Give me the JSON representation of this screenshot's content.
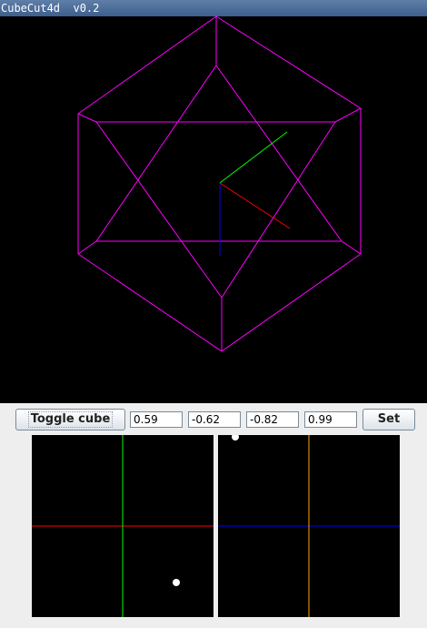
{
  "window": {
    "title": "CubeCut4d  v0.2"
  },
  "controls": {
    "toggle_label": "Toggle cube",
    "set_label": "Set",
    "fields": [
      "0.59",
      "-0.62",
      "-0.82",
      "0.99"
    ]
  },
  "colors": {
    "background": "#000000",
    "cube_edges": "#ff00ff",
    "axis_x": "#ff0000",
    "axis_y": "#00ff00",
    "axis_z": "#0000ff",
    "axis_w": "#ffa500",
    "marker": "#ffffff"
  }
}
